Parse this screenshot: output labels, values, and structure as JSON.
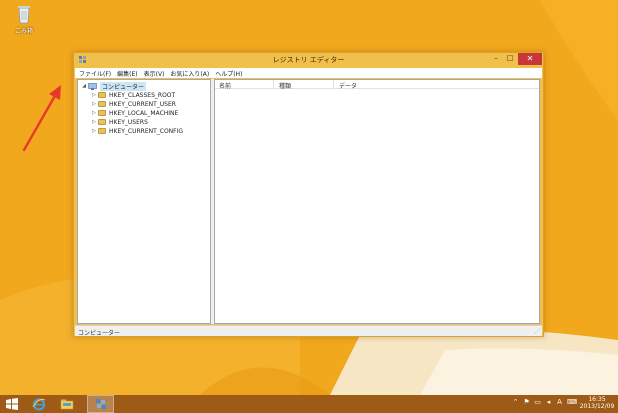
{
  "desktop": {
    "recycle_bin_label": "ごみ箱",
    "colors": {
      "wallpaper": "#f2a81c",
      "taskbar": "#9e5a17",
      "arrow": "#e8382a"
    }
  },
  "window": {
    "title": "レジストリ エディター",
    "controls": {
      "minimize": "–",
      "maximize": "□",
      "close": "✕"
    },
    "menu": [
      "ファイル(F)",
      "編集(E)",
      "表示(V)",
      "お気に入り(A)",
      "ヘルプ(H)"
    ],
    "tree": {
      "root": {
        "label": "コンピューター",
        "expander": "◢"
      },
      "children": [
        {
          "label": "HKEY_CLASSES_ROOT",
          "expander": "▷"
        },
        {
          "label": "HKEY_CURRENT_USER",
          "expander": "▷"
        },
        {
          "label": "HKEY_LOCAL_MACHINE",
          "expander": "▷"
        },
        {
          "label": "HKEY_USERS",
          "expander": "▷"
        },
        {
          "label": "HKEY_CURRENT_CONFIG",
          "expander": "▷"
        }
      ]
    },
    "list_columns": [
      "名前",
      "種類",
      "データ"
    ],
    "status_text": "コンピューター",
    "accent_color": "#f1c04b",
    "close_color": "#c7373a"
  },
  "taskbar": {
    "icons": [
      "windows-start-icon",
      "internet-explorer-icon",
      "file-explorer-icon",
      "registry-editor-icon"
    ],
    "clock_time": "16:35",
    "clock_date": "2013/12/09"
  }
}
